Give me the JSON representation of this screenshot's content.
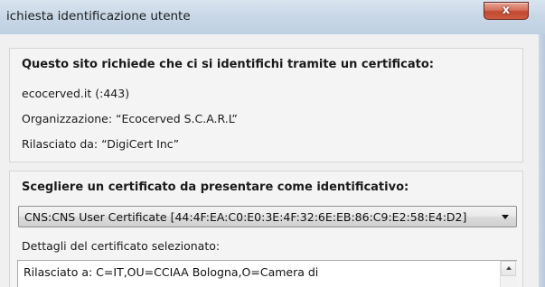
{
  "window": {
    "title": "ichiesta identificazione utente",
    "close_label": "x"
  },
  "site_section": {
    "heading": "Questo sito richiede che ci si identifichi tramite un certificato:",
    "host": "ecocerved.it (:443)",
    "organization": "Organizzazione: “Ecocerved S.C.A.R.L”",
    "issuer": "Rilasciato da: “DigiCert Inc”"
  },
  "certificate_section": {
    "heading": "Scegliere un certificato da presentare come identificativo:",
    "selected_certificate": "CNS:CNS User Certificate [44:4F:EA:C0:E0:3E:4F:32:6E:EB:86:C9:E2:58:E4:D2]",
    "details_label": "Dettagli del certificato selezionato:",
    "details_text": "Rilasciato a: C=IT,OU=CCIAA Bologna,O=Camera di"
  },
  "icons": {
    "close": "close-icon",
    "dropdown": "chevron-down-icon",
    "scroll_up": "scroll-up-arrow-icon"
  },
  "colors": {
    "titlebar": "#c8d7e6",
    "close_button": "#c24a32",
    "background": "#f0f0f0"
  }
}
